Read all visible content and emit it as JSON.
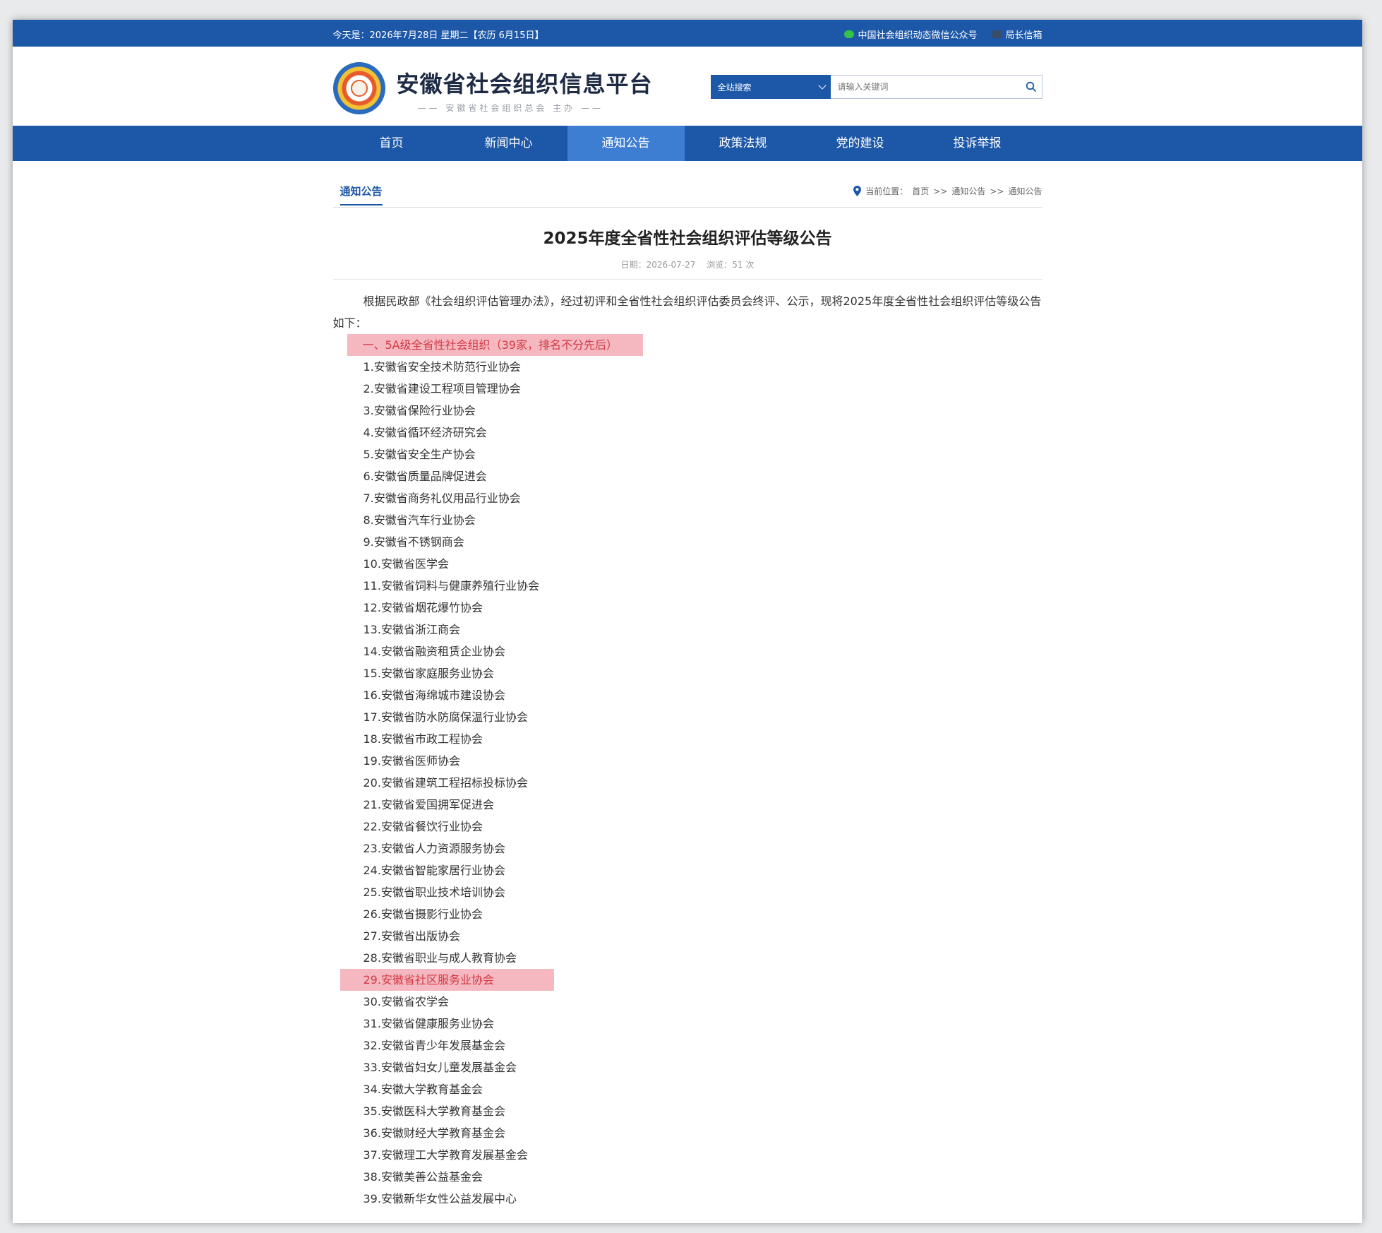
{
  "topbar": {
    "date": "今天是：2026年7月28日 星期二【农历 6月15日】",
    "wechat_link": "中国社会组织动态微信公众号",
    "leader_link": "局长信箱"
  },
  "header": {
    "site_name": "安徽省社会组织信息平台",
    "subtitle": "—— 安徽省社会组织总会  主办 ——",
    "search_scope": "全站搜索",
    "search_placeholder": "请输入关键词"
  },
  "nav": {
    "items": [
      "首页",
      "新闻中心",
      "通知公告",
      "政策法规",
      "党的建设",
      "投诉举报"
    ],
    "active": "通知公告"
  },
  "section": {
    "tab": "通知公告",
    "breadcrumb_label": "当前位置：",
    "breadcrumb": [
      "首页",
      "通知公告",
      "通知公告"
    ],
    "separator": ">>"
  },
  "article": {
    "title": "2025年度全省性社会组织评估等级公告",
    "date": "日期：2026-07-27",
    "views": "浏览：51 次",
    "intro": "根据民政部《社会组织评估管理办法》，经过初评和全省性社会组织评估委员会终评、公示，现将2025年度全省性社会组织评估等级公告如下：",
    "heading": "一、5A级全省性社会组织（39家，排名不分先后）",
    "items": [
      "1.安徽省安全技术防范行业协会",
      "2.安徽省建设工程项目管理协会",
      "3.安徽省保险行业协会",
      "4.安徽省循环经济研究会",
      "5.安徽省安全生产协会",
      "6.安徽省质量品牌促进会",
      "7.安徽省商务礼仪用品行业协会",
      "8.安徽省汽车行业协会",
      "9.安徽省不锈钢商会",
      "10.安徽省医学会",
      "11.安徽省饲料与健康养殖行业协会",
      "12.安徽省烟花爆竹协会",
      "13.安徽省浙江商会",
      "14.安徽省融资租赁企业协会",
      "15.安徽省家庭服务业协会",
      "16.安徽省海绵城市建设协会",
      "17.安徽省防水防腐保温行业协会",
      "18.安徽省市政工程协会",
      "19.安徽省医师协会",
      "20.安徽省建筑工程招标投标协会",
      "21.安徽省爱国拥军促进会",
      "22.安徽省餐饮行业协会",
      "23.安徽省人力资源服务协会",
      "24.安徽省智能家居行业协会",
      "25.安徽省职业技术培训协会",
      "26.安徽省摄影行业协会",
      "27.安徽省出版协会",
      "28.安徽省职业与成人教育协会",
      "29.安徽省社区服务业协会",
      "30.安徽省农学会",
      "31.安徽省健康服务业协会",
      "32.安徽省青少年发展基金会",
      "33.安徽省妇女儿童发展基金会",
      "34.安徽大学教育基金会",
      "35.安徽医科大学教育基金会",
      "36.安徽财经大学教育基金会",
      "37.安徽理工大学教育发展基金会",
      "38.安徽美善公益基金会",
      "39.安徽新华女性公益发展中心"
    ],
    "highlighted_item_index": 28,
    "highlight_color": "#f5b8c0"
  },
  "colors": {
    "brand_blue": "#1c57a8",
    "nav_active": "#3d7dd2",
    "highlight_text": "#d23a45"
  }
}
